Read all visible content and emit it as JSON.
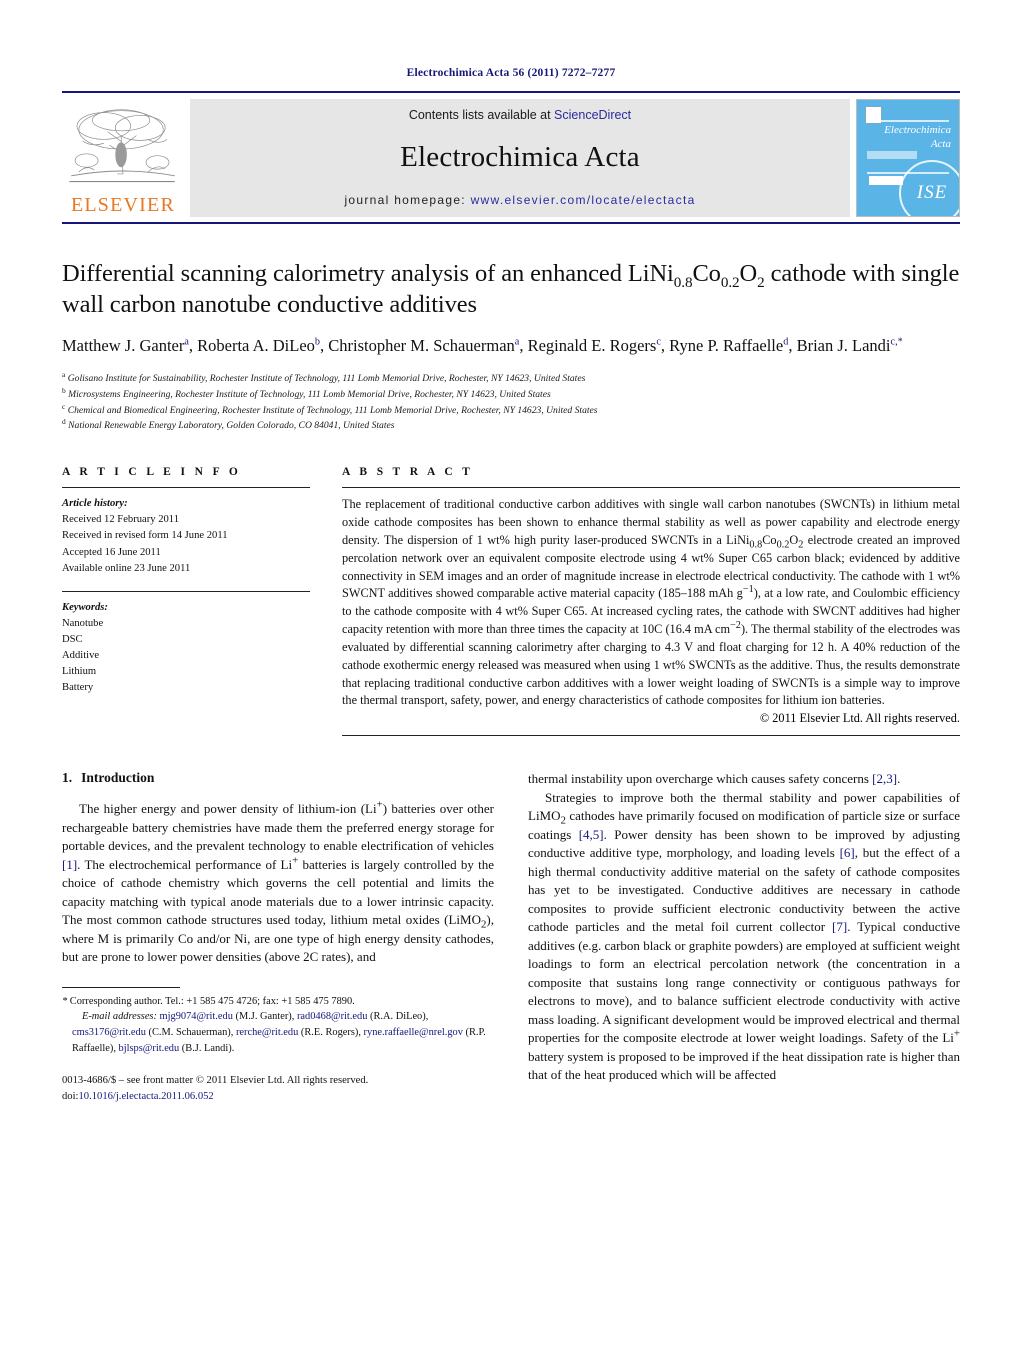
{
  "running_head": "Electrochimica Acta 56 (2011) 7272–7277",
  "masthead": {
    "publisher_logo_label": "ELSEVIER",
    "contents_prefix": "Contents lists available at ",
    "contents_link": "ScienceDirect",
    "journal_name": "Electrochimica Acta",
    "homepage_prefix": "journal homepage: ",
    "homepage_url": "www.elsevier.com/locate/electacta",
    "cover": {
      "title_line1": "Electrochimica",
      "title_line2": "Acta",
      "society_mark": "ISE"
    },
    "rule_color": "#16167a",
    "banner_bg": "#e6e6e6",
    "cover_bg": "#5ab4e5",
    "elsevier_orange": "#e87722"
  },
  "article": {
    "title_html": "Differential scanning calorimetry analysis of an enhanced LiNi<sub>0.8</sub>Co<sub>0.2</sub>O<sub>2</sub> cathode with single wall carbon nanotube conductive additives",
    "authors_html": "Matthew J. Ganter<sup>a</sup>, Roberta A. DiLeo<sup>b</sup>, Christopher M. Schauerman<sup>a</sup>, Reginald E. Rogers<sup>c</sup>, Ryne P. Raffaelle<sup>d</sup>, Brian J. Landi<sup>c,</sup><sup>*</sup>",
    "affiliations": [
      {
        "marker": "a",
        "text": "Golisano Institute for Sustainability, Rochester Institute of Technology, 111 Lomb Memorial Drive, Rochester, NY 14623, United States"
      },
      {
        "marker": "b",
        "text": "Microsystems Engineering, Rochester Institute of Technology, 111 Lomb Memorial Drive, Rochester, NY 14623, United States"
      },
      {
        "marker": "c",
        "text": "Chemical and Biomedical Engineering, Rochester Institute of Technology, 111 Lomb Memorial Drive, Rochester, NY 14623, United States"
      },
      {
        "marker": "d",
        "text": "National Renewable Energy Laboratory, Golden Colorado, CO 84041, United States"
      }
    ]
  },
  "article_info": {
    "heading": "A R T I C L E  I N F O",
    "history_label": "Article history:",
    "history": [
      "Received 12 February 2011",
      "Received in revised form 14 June 2011",
      "Accepted 16 June 2011",
      "Available online 23 June 2011"
    ],
    "keywords_label": "Keywords:",
    "keywords": [
      "Nanotube",
      "DSC",
      "Additive",
      "Lithium",
      "Battery"
    ]
  },
  "abstract": {
    "heading": "A B S T R A C T",
    "body_html": "The replacement of traditional conductive carbon additives with single wall carbon nanotubes (SWCNTs) in lithium metal oxide cathode composites has been shown to enhance thermal stability as well as power capability and electrode energy density. The dispersion of 1 wt% high purity laser-produced SWCNTs in a LiNi<sub>0.8</sub>Co<sub>0.2</sub>O<sub>2</sub> electrode created an improved percolation network over an equivalent composite electrode using 4 wt% Super C65 carbon black; evidenced by additive connectivity in SEM images and an order of magnitude increase in electrode electrical conductivity. The cathode with 1 wt% SWCNT additives showed comparable active material capacity (185&#8211;188 mAh g<sup>&#8722;1</sup>), at a low rate, and Coulombic efficiency to the cathode composite with 4 wt% Super C65. At increased cycling rates, the cathode with SWCNT additives had higher capacity retention with more than three times the capacity at 10C (16.4 mA cm<sup>&#8722;2</sup>). The thermal stability of the electrodes was evaluated by differential scanning calorimetry after charging to 4.3 V and float charging for 12 h. A 40% reduction of the cathode exothermic energy released was measured when using 1 wt% SWCNTs as the additive. Thus, the results demonstrate that replacing traditional conductive carbon additives with a lower weight loading of SWCNTs is a simple way to improve the thermal transport, safety, power, and energy characteristics of cathode composites for lithium ion batteries.",
    "copyright": "© 2011 Elsevier Ltd. All rights reserved."
  },
  "introduction": {
    "number": "1.",
    "heading": "Introduction",
    "left_paragraph_html": "The higher energy and power density of lithium-ion (Li<sup>+</sup>) batteries over other rechargeable battery chemistries have made them the preferred energy storage for portable devices, and the prevalent technology to enable electrification of vehicles <span class=\"ref\">[1]</span>. The electrochemical performance of Li<sup>+</sup> batteries is largely controlled by the choice of cathode chemistry which governs the cell potential and limits the capacity matching with typical anode materials due to a lower intrinsic capacity. The most common cathode structures used today, lithium metal oxides (LiMO<sub>2</sub>), where M is primarily Co and/or Ni, are one type of high energy density cathodes, but are prone to lower power densities (above 2C rates), and",
    "right_paragraph_cont_html": "thermal instability upon overcharge which causes safety concerns <span class=\"ref\">[2,3]</span>.",
    "right_paragraph_html": "Strategies to improve both the thermal stability and power capabilities of LiMO<sub>2</sub> cathodes have primarily focused on modification of particle size or surface coatings <span class=\"ref\">[4,5]</span>. Power density has been shown to be improved by adjusting conductive additive type, morphology, and loading levels <span class=\"ref\">[6]</span>, but the effect of a high thermal conductivity additive material on the safety of cathode composites has yet to be investigated. Conductive additives are necessary in cathode composites to provide sufficient electronic conductivity between the active cathode particles and the metal foil current collector <span class=\"ref\">[7]</span>. Typical conductive additives (e.g. carbon black or graphite powders) are employed at sufficient weight loadings to form an electrical percolation network (the concentration in a composite that sustains long range connectivity or contiguous pathways for electrons to move), and to balance sufficient electrode conductivity with active mass loading. A significant development would be improved electrical and thermal properties for the composite electrode at lower weight loadings. Safety of the Li<sup>+</sup> battery system is proposed to be improved if the heat dissipation rate is higher than that of the heat produced which will be affected"
  },
  "footnotes": {
    "corresponding_html": "<span class=\"em\">*</span> Corresponding author. Tel.: +1 585 475 4726; fax: +1 585 475 7890.",
    "emails_html": "<span class=\"em\">E-mail addresses:</span> <span class=\"mail\">mjg9074@rit.edu</span> (M.J. Ganter), <span class=\"mail\">rad0468@rit.edu</span> (R.A. DiLeo), <span class=\"mail\">cms3176@rit.edu</span> (C.M. Schauerman), <span class=\"mail\">rerche@rit.edu</span> (R.E. Rogers), <span class=\"mail\">ryne.raffaelle@nrel.gov</span> (R.P. Raffaelle), <span class=\"mail\">bjlsps@rit.edu</span> (B.J. Landi).",
    "frontmatter": "0013-4686/$ – see front matter © 2011 Elsevier Ltd. All rights reserved.",
    "doi_label": "doi:",
    "doi_value": "10.1016/j.electacta.2011.06.052"
  }
}
